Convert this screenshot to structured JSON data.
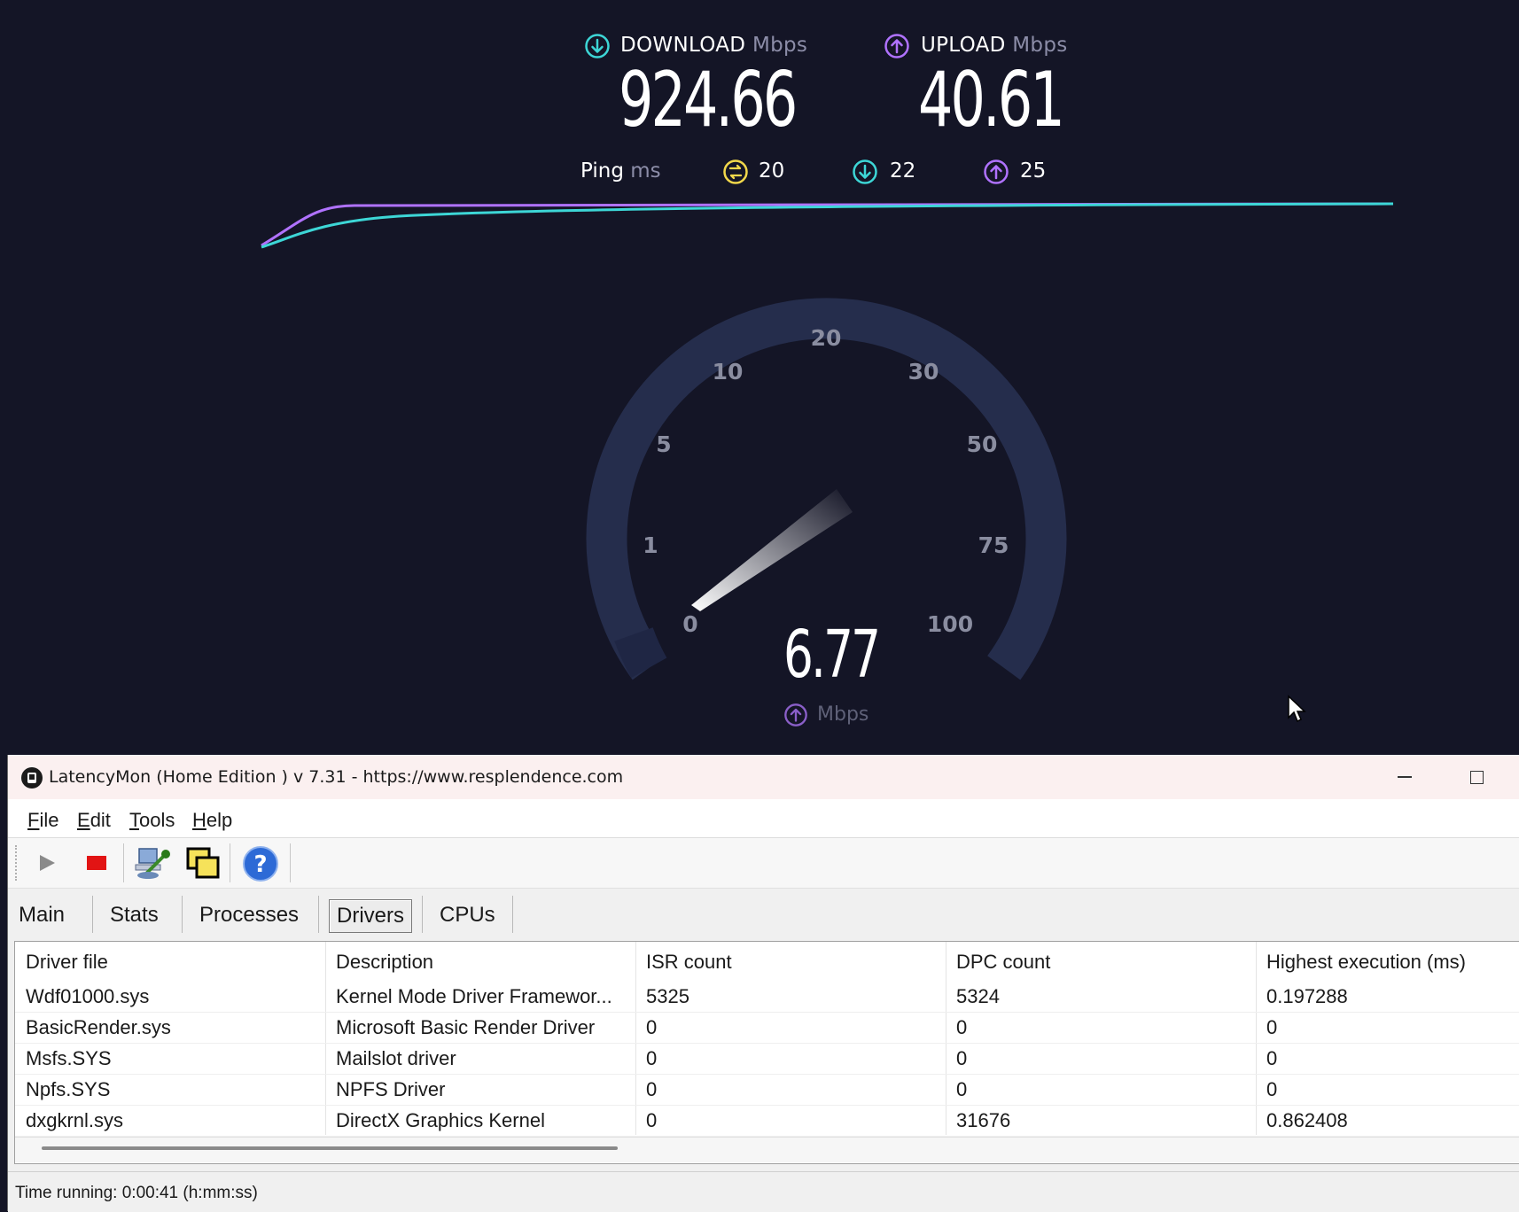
{
  "speedtest": {
    "download": {
      "label": "DOWNLOAD",
      "unit": "Mbps",
      "value": "924.66",
      "color": "#3dd6d6"
    },
    "upload": {
      "label": "UPLOAD",
      "unit": "Mbps",
      "value": "40.61",
      "color": "#b072ff"
    },
    "ping": {
      "label": "Ping",
      "unit": "ms",
      "idle": "20",
      "download": "22",
      "upload": "25",
      "idle_color": "#f2d84b"
    },
    "gauge": {
      "ticks": [
        "0",
        "1",
        "5",
        "10",
        "20",
        "30",
        "50",
        "75",
        "100"
      ],
      "value": "6.77",
      "unit": "Mbps",
      "needle_value": 6.77
    }
  },
  "window": {
    "title": "LatencyMon  (Home Edition )  v 7.31 - https://www.resplendence.com",
    "menu": [
      "File",
      "Edit",
      "Tools",
      "Help"
    ],
    "menu_mnemonics": [
      "F",
      "E",
      "T",
      "H"
    ],
    "tabs": [
      "Main",
      "Stats",
      "Processes",
      "Drivers",
      "CPUs"
    ],
    "active_tab": "Drivers",
    "table": {
      "columns": [
        "Driver file",
        "Description",
        "ISR count",
        "DPC count",
        "Highest execution (ms)"
      ],
      "rows": [
        [
          "Wdf01000.sys",
          "Kernel Mode Driver Framewor...",
          "5325",
          "5324",
          "0.197288"
        ],
        [
          "BasicRender.sys",
          "Microsoft Basic Render Driver",
          "0",
          "0",
          "0"
        ],
        [
          "Msfs.SYS",
          "Mailslot driver",
          "0",
          "0",
          "0"
        ],
        [
          "Npfs.SYS",
          "NPFS Driver",
          "0",
          "0",
          "0"
        ],
        [
          "dxgkrnl.sys",
          "DirectX Graphics Kernel",
          "0",
          "31676",
          "0.862408"
        ]
      ]
    },
    "status": "Time running: 0:00:41  (h:mm:ss)"
  }
}
